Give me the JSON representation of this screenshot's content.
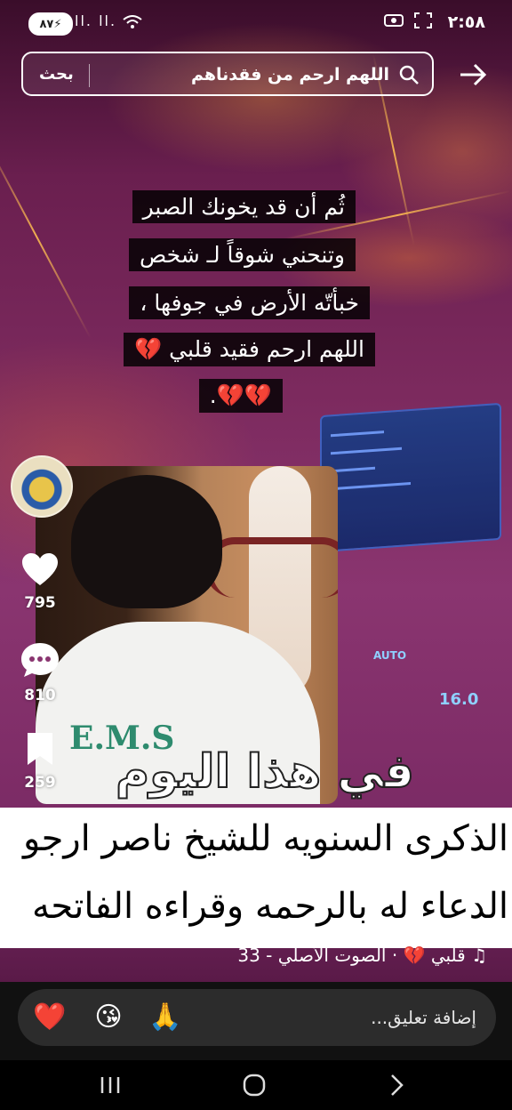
{
  "status_bar": {
    "time": "٢:٥٨",
    "battery": "٨٧",
    "battery_icon": "battery-charging-icon",
    "signal": "ll. ll.",
    "wifi": "wifi-icon"
  },
  "search": {
    "query": "اللهم ارحم من فقدناهم",
    "button_label": "بحث"
  },
  "lyrics": [
    "ثُم أن قد يخونك الصبر",
    "وتنحني شوقاً لـ شخص",
    "خبأتّه الأرض في جوفها ،",
    "اللهم ارحم فقيد قلبي 💔",
    "💔💔."
  ],
  "actions": {
    "likes": "795",
    "comments": "810",
    "saves": "259"
  },
  "photo": {
    "shirt_text": "E.M.S"
  },
  "overlay_title": "في هذا اليوم",
  "caption": {
    "line1": "الذكرى السنويه للشيخ ناصر ارجو",
    "line2": "الدعاء له بالرحمه وقراءه الفاتحه"
  },
  "music": {
    "label": "♫ قلبي 💔 · الصوت الأصلي - 33"
  },
  "comment": {
    "placeholder": "إضافة تعليق...",
    "emojis": [
      "🙏",
      "😘",
      "❤️"
    ]
  },
  "colors": {
    "video_tint": "#7c2a5e",
    "comment_bar": "#2c2c2c",
    "caption_bg": "#ffffff"
  }
}
